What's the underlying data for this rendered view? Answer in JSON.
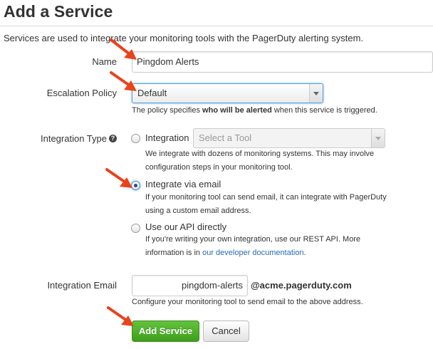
{
  "page": {
    "title": "Add a Service",
    "intro": "Services are used to integrate your monitoring tools with the PagerDuty alerting system."
  },
  "form": {
    "name": {
      "label": "Name",
      "value": "Pingdom Alerts"
    },
    "escalation_policy": {
      "label": "Escalation Policy",
      "selected": "Default",
      "help_before": "The policy specifies ",
      "help_bold": "who will be alerted",
      "help_after": " when this service is triggered."
    },
    "integration_type": {
      "label": "Integration Type",
      "options": [
        {
          "label": "Integration",
          "checked": false,
          "select_placeholder": "Select a Tool",
          "help_line1": "We integrate with dozens of monitoring systems. This may involve",
          "help_line2": "configuration steps in your monitoring tool."
        },
        {
          "label": "Integrate via email",
          "checked": true,
          "help_line1": "If your monitoring tool can send email, it can integrate with PagerDuty",
          "help_line2": "using a custom email address."
        },
        {
          "label": "Use our API directly",
          "checked": false,
          "help_line1": "If you're writing your own integration, use our REST API. More",
          "help_line2_before": "information is in ",
          "help_link": "our developer documentation",
          "help_line2_after": "."
        }
      ]
    },
    "integration_email": {
      "label": "Integration Email",
      "value": "pingdom-alerts",
      "domain": "@acme.pagerduty.com",
      "help": "Configure your monitoring tool to send email to the above address."
    }
  },
  "actions": {
    "submit": "Add Service",
    "cancel": "Cancel"
  },
  "colors": {
    "primary_button": "#4cae2a",
    "annotation_arrow": "#e8431b",
    "link": "#2a6ab0"
  },
  "icons": {
    "help": "question-circle-icon",
    "annotation": "red-arrow-icon"
  }
}
